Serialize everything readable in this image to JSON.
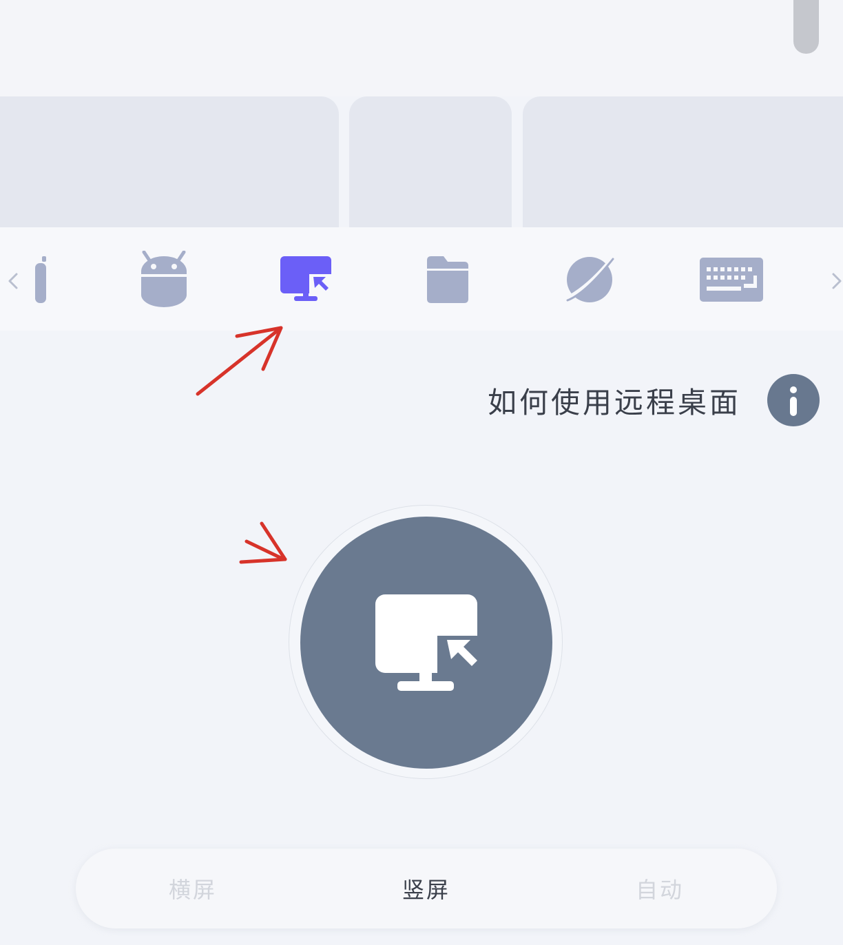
{
  "toolbar": {
    "items": [
      {
        "icon": "partial-icon"
      },
      {
        "icon": "android-icon"
      },
      {
        "icon": "remote-desktop-icon",
        "selected": true
      },
      {
        "icon": "folder-icon"
      },
      {
        "icon": "planet-icon"
      },
      {
        "icon": "keyboard-icon"
      }
    ],
    "prev_icon": "chevron-left-icon",
    "next_icon": "chevron-right-icon"
  },
  "help": {
    "text": "如何使用远程桌面",
    "icon": "info-icon"
  },
  "main_button": {
    "icon": "remote-desktop-icon"
  },
  "orientation": {
    "options": [
      "横屏",
      "竖屏",
      "自动"
    ],
    "selected": "竖屏"
  },
  "colors": {
    "accent": "#6b5ff7",
    "icon_default": "#a5aec9",
    "button": "#6a7a90",
    "annotation": "#d7332a"
  }
}
